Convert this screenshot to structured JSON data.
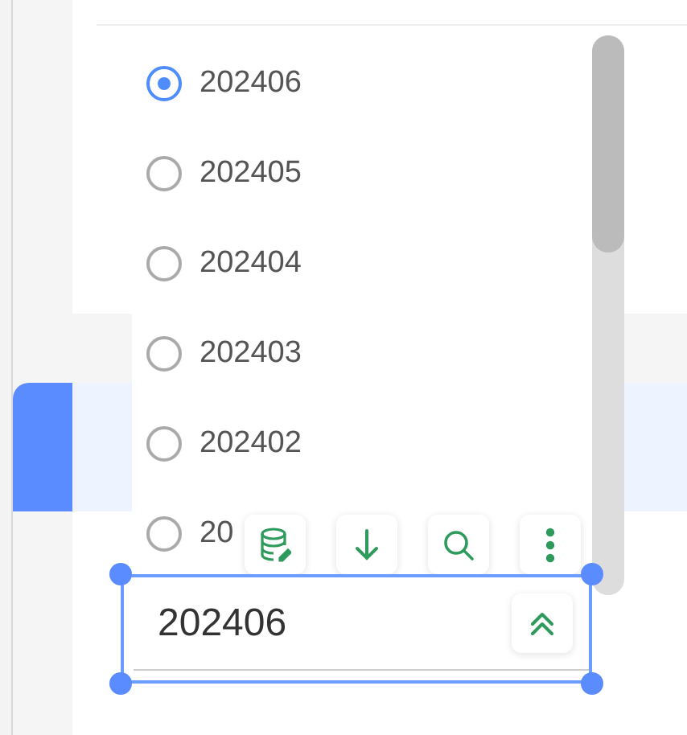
{
  "dropdown": {
    "options": [
      {
        "label": "202406",
        "selected": true
      },
      {
        "label": "202405",
        "selected": false
      },
      {
        "label": "202404",
        "selected": false
      },
      {
        "label": "202403",
        "selected": false
      },
      {
        "label": "202402",
        "selected": false
      },
      {
        "label": "20",
        "selected": false
      }
    ]
  },
  "field": {
    "value": "202406",
    "expanded": true,
    "selected": true
  }
}
